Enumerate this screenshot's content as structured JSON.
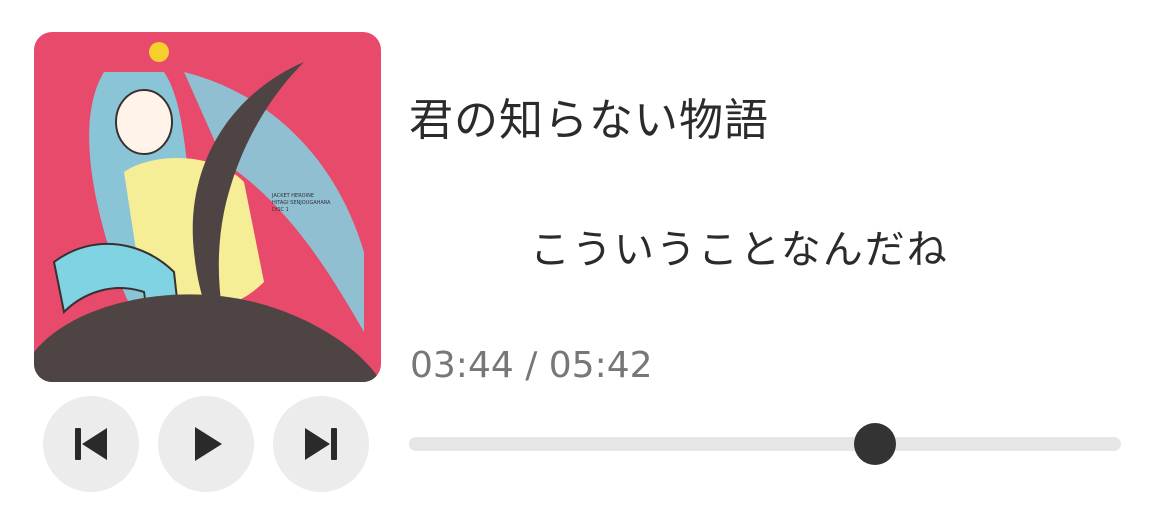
{
  "player": {
    "title": "君の知らない物語",
    "lyric": "こういうことなんだね",
    "current_time": "03:44",
    "duration": "05:42",
    "time_display": "03:44 / 05:42",
    "progress": 0.6549
  },
  "controls": {
    "previous_icon": "skip-previous-icon",
    "play_icon": "play-icon",
    "next_icon": "skip-next-icon"
  },
  "colors": {
    "art_background": "#e84a6b",
    "text": "#2b2b2b",
    "time_text": "#777777",
    "button_bg": "#ececec",
    "track": "#e6e6e6",
    "thumb": "#333333"
  }
}
